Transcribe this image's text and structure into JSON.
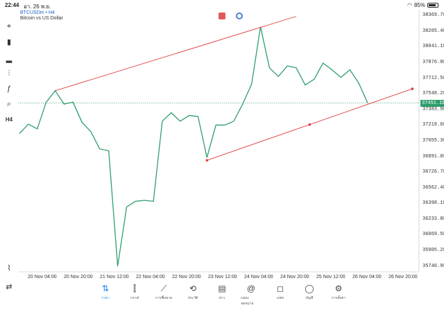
{
  "status_bar": {
    "time": "22:44",
    "date": "อา. 26 พ.ย.",
    "battery": "85%",
    "battery_level": 0.85
  },
  "symbol": {
    "title": "BTCUSDm • H4",
    "subtitle": "Bitcoin vs US Dollar"
  },
  "toolbar": [
    {
      "name": "crosshair-icon",
      "glyph": "⌖"
    },
    {
      "name": "candlestick-icon",
      "glyph": "▮"
    },
    {
      "name": "indicators-icon",
      "glyph": "▂"
    },
    {
      "name": "settings-sliders-icon",
      "glyph": "⫶"
    },
    {
      "name": "function-icon",
      "glyph": "ƒ"
    },
    {
      "name": "objects-icon",
      "glyph": "⌕"
    },
    {
      "name": "timeframe-icon",
      "glyph": "H4"
    }
  ],
  "price_axis": [
    "38369.70",
    "38205.40",
    "38041.10",
    "37876.80",
    "37712.50",
    "37548.20",
    "37383.90",
    "37219.60",
    "37055.30",
    "36891.00",
    "36726.70",
    "36562.40",
    "36398.10",
    "36233.80",
    "36069.50",
    "35905.20",
    "35740.90"
  ],
  "current_price": "37451.18",
  "current_price_value": 37451.18,
  "time_axis": [
    "20 Nov 04:00",
    "20 Nov 20:00",
    "21 Nov 12:00",
    "22 Nov 04:00",
    "22 Nov 20:00",
    "23 Nov 12:00",
    "24 Nov 04:00",
    "24 Nov 20:00",
    "25 Nov 12:00",
    "26 Nov 04:00",
    "26 Nov 20:00"
  ],
  "chart_data": {
    "type": "line",
    "series": [
      {
        "values": [
          37130,
          37230,
          37180,
          37460,
          37580,
          37440,
          37460,
          37250,
          37150,
          36970,
          36950,
          35740,
          36360,
          36420,
          36430,
          36420,
          37260,
          37350,
          37260,
          37320,
          37310,
          36880,
          37220,
          37220,
          37260,
          37440,
          37650,
          38250,
          37820,
          37730,
          37840,
          37820,
          37640,
          37700,
          37870,
          37800,
          37720,
          37800,
          37660,
          37451
        ]
      }
    ],
    "trendlines": [
      {
        "x": [
          4,
          31
        ],
        "y": [
          37580,
          38360
        ]
      },
      {
        "x": [
          21,
          44
        ],
        "y": [
          36850,
          37600
        ],
        "markers": true
      }
    ],
    "ylim": [
      35680,
      38430
    ],
    "colors": {
      "line": "#2e9e6b",
      "trend": "#e03a3a",
      "price_line": "#2e9e6b"
    }
  },
  "nav": [
    {
      "name": "nav-quotes",
      "icon": "⇅",
      "label": "ราคา",
      "active": true
    },
    {
      "name": "nav-chart",
      "icon": "⫿",
      "label": "กราฟ"
    },
    {
      "name": "nav-trade",
      "icon": "⟋",
      "label": "การซื้อขาย"
    },
    {
      "name": "nav-history",
      "icon": "⟲",
      "label": "ประวัติ"
    },
    {
      "name": "nav-news",
      "icon": "▤",
      "label": "ข่าว"
    },
    {
      "name": "nav-mailbox",
      "icon": "@",
      "label": "กล่องจดหมาย"
    },
    {
      "name": "nav-chat",
      "icon": "◻",
      "label": "แชท"
    },
    {
      "name": "nav-account",
      "icon": "◯",
      "label": "บัญชี"
    },
    {
      "name": "nav-settings",
      "icon": "⚙",
      "label": "การตั้งค่า"
    }
  ]
}
